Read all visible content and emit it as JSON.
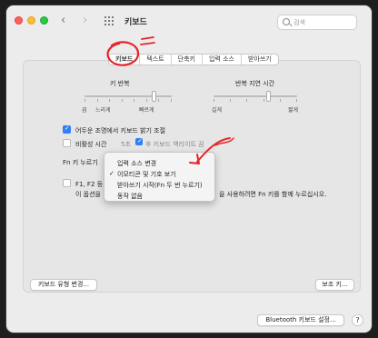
{
  "window": {
    "title": "키보드",
    "search_placeholder": "검색"
  },
  "colors": {
    "accent": "#2f7ff5",
    "annotation": "#e5262b"
  },
  "tabs": [
    "키보드",
    "텍스트",
    "단축키",
    "입력 소스",
    "받아쓰기"
  ],
  "key_repeat": {
    "label": "키 반복",
    "min_label": "끔",
    "slow_label": "느리게",
    "fast_label": "빠르게"
  },
  "repeat_delay": {
    "label": "반복 지연 시간",
    "long_label": "길게",
    "short_label": "짧게"
  },
  "options": {
    "backlight_label": "어두운 조명에서 키보드 밝기 조절",
    "backlight_checked": true,
    "inactive_label_start": "비활성 시간",
    "inactive_value": "5초",
    "inactive_label_end": "후 키보드 백라이트 끔",
    "inactive_checked": false,
    "fn_key_label": "Fn 키 누르기",
    "f_keys_label_line1": "F1, F2 등",
    "f_keys_label_line2_start": "이 옵션을",
    "f_keys_label_line2_end": "을 사용하려면 Fn 키를 함께 누르십시오."
  },
  "menu": {
    "items": [
      "입력 소스 변경",
      "이모티콘 및 기호 보기",
      "받아쓰기 시작(Fn 두 번 누르기)",
      "동작 없음"
    ],
    "checkmark": "✓"
  },
  "buttons": {
    "keyboard_type": "키보드 유형 변경...",
    "modifier_keys": "보조 키...",
    "bluetooth": "Bluetooth 키보드 설정...",
    "help": "?"
  }
}
